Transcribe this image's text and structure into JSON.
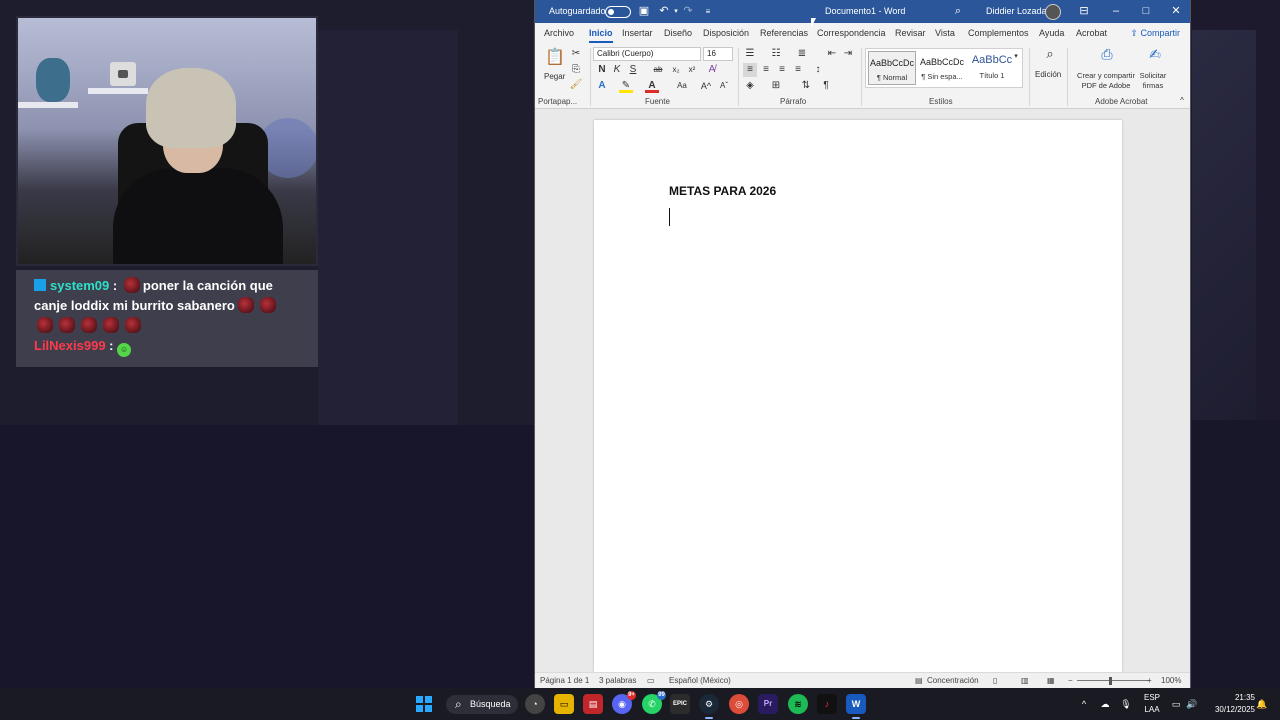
{
  "stream": {
    "chat": {
      "msg1_user": "system09",
      "msg1_sep": ":",
      "msg1_text": "poner la canción que canje loddix mi burrito sabanero",
      "msg2_user": "LilNexis999",
      "msg2_sep": ":",
      "colors": {
        "user1": "#2be0c8",
        "user2": "#ff3a4a",
        "prime": "#1aa0e8"
      }
    }
  },
  "word": {
    "autosave_label": "Autoguardado",
    "doc_title": "Documento1 - Word",
    "user_name": "Diddier Lozada",
    "tabs": [
      "Archivo",
      "Inicio",
      "Insertar",
      "Diseño",
      "Disposición",
      "Referencias",
      "Correspondencia",
      "Revisar",
      "Vista",
      "Complementos",
      "Ayuda",
      "Acrobat"
    ],
    "share_label": "Compartir",
    "ribbon": {
      "paste_label": "Pegar",
      "clipboard_label": "Portapap...",
      "font_name": "Calibri (Cuerpo)",
      "font_size": "16",
      "font_group_label": "Fuente",
      "paragraph_label": "Párrafo",
      "styles_label": "Estilos",
      "styles": [
        {
          "sample": "AaBbCcDc",
          "name": "¶ Normal"
        },
        {
          "sample": "AaBbCcDc",
          "name": "¶ Sin espa..."
        },
        {
          "sample": "AaBbCc",
          "name": "Título 1"
        }
      ],
      "editing_label": "Edición",
      "create_pdf_label": "Crear y compartir PDF de Adobe",
      "request_sign_label": "Solicitar firmas",
      "acrobat_group_label": "Adobe Acrobat",
      "bold": "N",
      "italic": "K",
      "underline": "S",
      "strike": "ab",
      "subscript": "x₂",
      "superscript": "x²"
    },
    "document": {
      "heading": "METAS PARA 2026"
    },
    "status": {
      "page": "Página 1 de 1",
      "words": "3 palabras",
      "language": "Español (México)",
      "focus": "Concentración",
      "zoom": "100%"
    }
  },
  "taskbar": {
    "search_label": "Búsqueda",
    "discord_badge": "9+",
    "whatsapp_badge": "99",
    "lang_top": "ESP",
    "lang_bottom": "LAA",
    "time": "21:35",
    "date": "30/12/2025"
  }
}
